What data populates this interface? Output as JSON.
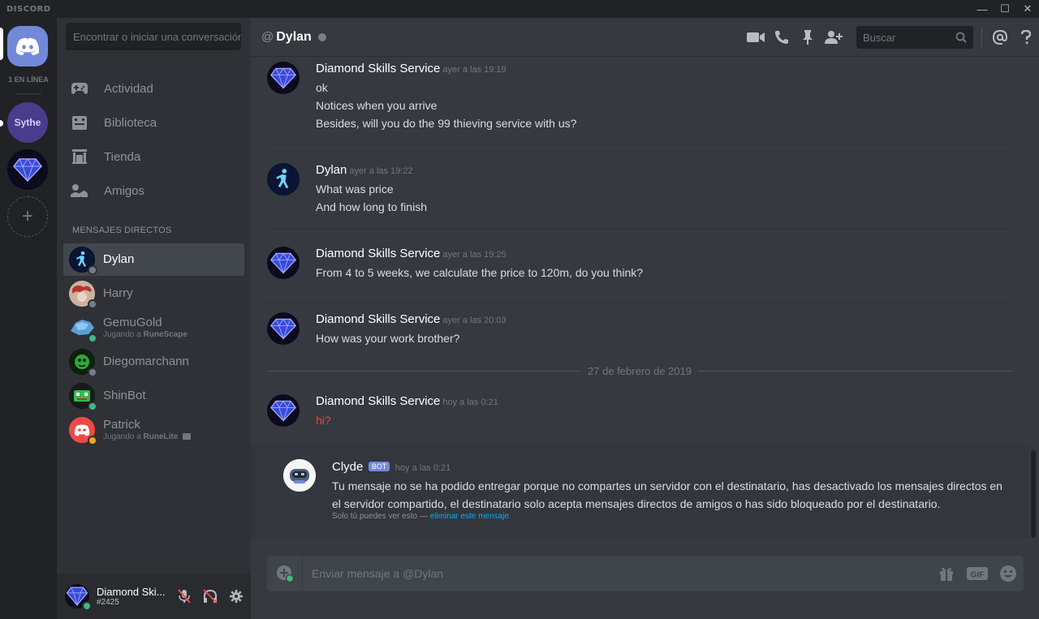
{
  "titlebar": {
    "app_name": "DISCORD",
    "minimize": "—",
    "maximize": "☐",
    "close": "✕"
  },
  "guilds": {
    "online_count": "1 EN LÍNEA",
    "sythe_label": "Sythe",
    "add_label": "+"
  },
  "sidebar": {
    "search_placeholder": "Encontrar o iniciar una conversación",
    "nav": [
      {
        "label": "Actividad",
        "icon": "gamepad-icon"
      },
      {
        "label": "Biblioteca",
        "icon": "library-icon"
      },
      {
        "label": "Tienda",
        "icon": "store-icon"
      },
      {
        "label": "Amigos",
        "icon": "friends-icon"
      }
    ],
    "dm_header": "MENSAJES DIRECTOS",
    "dms": [
      {
        "name": "Dylan",
        "sub_prefix": "",
        "sub_game": "",
        "status": "offline"
      },
      {
        "name": "Harry",
        "sub_prefix": "",
        "sub_game": "",
        "status": "offline"
      },
      {
        "name": "GemuGold",
        "sub_prefix": "Jugando a ",
        "sub_game": "RuneScape",
        "status": "online"
      },
      {
        "name": "Diegomarchann",
        "sub_prefix": "",
        "sub_game": "",
        "status": "offline"
      },
      {
        "name": "ShinBot",
        "sub_prefix": "",
        "sub_game": "",
        "status": "online"
      },
      {
        "name": "Patrick",
        "sub_prefix": "Jugando a ",
        "sub_game": "RuneLite",
        "status": "idle"
      }
    ]
  },
  "user": {
    "name": "Diamond Ski...",
    "tag": "#2425"
  },
  "chat": {
    "header": {
      "at": "@",
      "name": "Dylan",
      "search_placeholder": "Buscar"
    },
    "messages": [
      {
        "author": "Diamond Skills Service",
        "time": "ayer a las 19:19",
        "lines": [
          "ok",
          "Notices when you arrive",
          "Besides, will you do the 99 thieving service with us?"
        ]
      },
      {
        "author": "Dylan",
        "time": "ayer a las 19:22",
        "lines": [
          "What was price",
          "And how long to finish"
        ]
      },
      {
        "author": "Diamond Skills Service",
        "time": "ayer a las 19:25",
        "lines": [
          "From 4 to 5 weeks, we calculate the price to 120m, do you think?"
        ]
      },
      {
        "author": "Diamond Skills Service",
        "time": "ayer a las 20:03",
        "lines": [
          "How was your work brother?"
        ]
      },
      {
        "author": "Diamond Skills Service",
        "time": "hoy a las 0:21",
        "lines": [
          "hi?"
        ]
      }
    ],
    "date_separator": "27 de febrero de 2019",
    "clyde": {
      "author": "Clyde",
      "badge": "BOT",
      "time": "hoy a las 0:21",
      "text": "Tu mensaje no se ha podido entregar porque no compartes un servidor con el destinatario, has desactivado los mensajes directos en el servidor compartido, el destinatario solo acepta mensajes directos de amigos o has sido bloqueado por el destinatario.",
      "note": "Solo tú puedes ver esto — ",
      "note_link": "eliminar este mensaje."
    },
    "composer_placeholder": "Enviar mensaje a @Dylan"
  },
  "colors": {
    "accent": "#7289da",
    "online": "#43b581",
    "idle": "#faa61a",
    "offline": "#747f8d",
    "error_text": "#f04747",
    "link": "#00b0f4"
  }
}
